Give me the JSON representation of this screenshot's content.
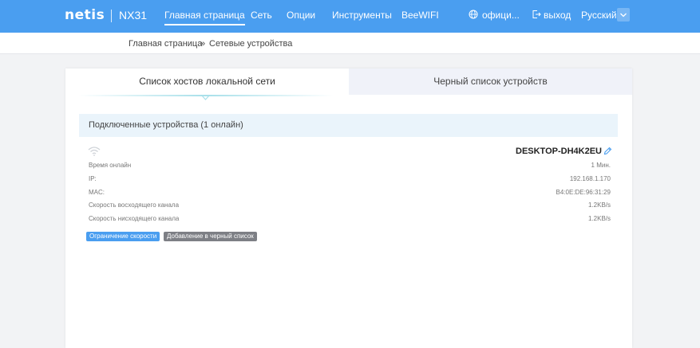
{
  "header": {
    "logo": "netis",
    "model": "NX31",
    "nav": [
      {
        "label": "Главная страница"
      },
      {
        "label": "Сеть"
      },
      {
        "label": "Опции"
      },
      {
        "label": "Инструменты"
      },
      {
        "label": "BeeWIFI"
      }
    ],
    "official_label": "офици...",
    "logout_label": "выход",
    "language": "Русский"
  },
  "breadcrumb": {
    "home": "Главная страница",
    "separator": "»",
    "current": "Сетевые устройства"
  },
  "tabs": {
    "hosts": "Список хостов локальной сети",
    "blacklist": "Черный список устройств"
  },
  "section": {
    "title": "Подключенные устройства (1 онлайн)"
  },
  "device": {
    "name": "DESKTOP-DH4K2EU",
    "rows": [
      {
        "label": "Время онлайн",
        "value": "1 Мин."
      },
      {
        "label": "IP:",
        "value": "192.168.1.170"
      },
      {
        "label": "MAC:",
        "value": "B4:0E:DE:96:31:29"
      },
      {
        "label": "Скорость восходящего канала",
        "value": "1.2KB/s"
      },
      {
        "label": "Скорость нисходящего канала",
        "value": "1.2KB/s"
      }
    ],
    "buttons": {
      "limit": "Ограничение скорости",
      "blacklist": "Добавление в черный список"
    }
  },
  "colors": {
    "header": "#4a9ef0",
    "accent": "#4a9ef0",
    "section_bg": "#eaf4fb",
    "gray_button": "#7d7f85"
  }
}
